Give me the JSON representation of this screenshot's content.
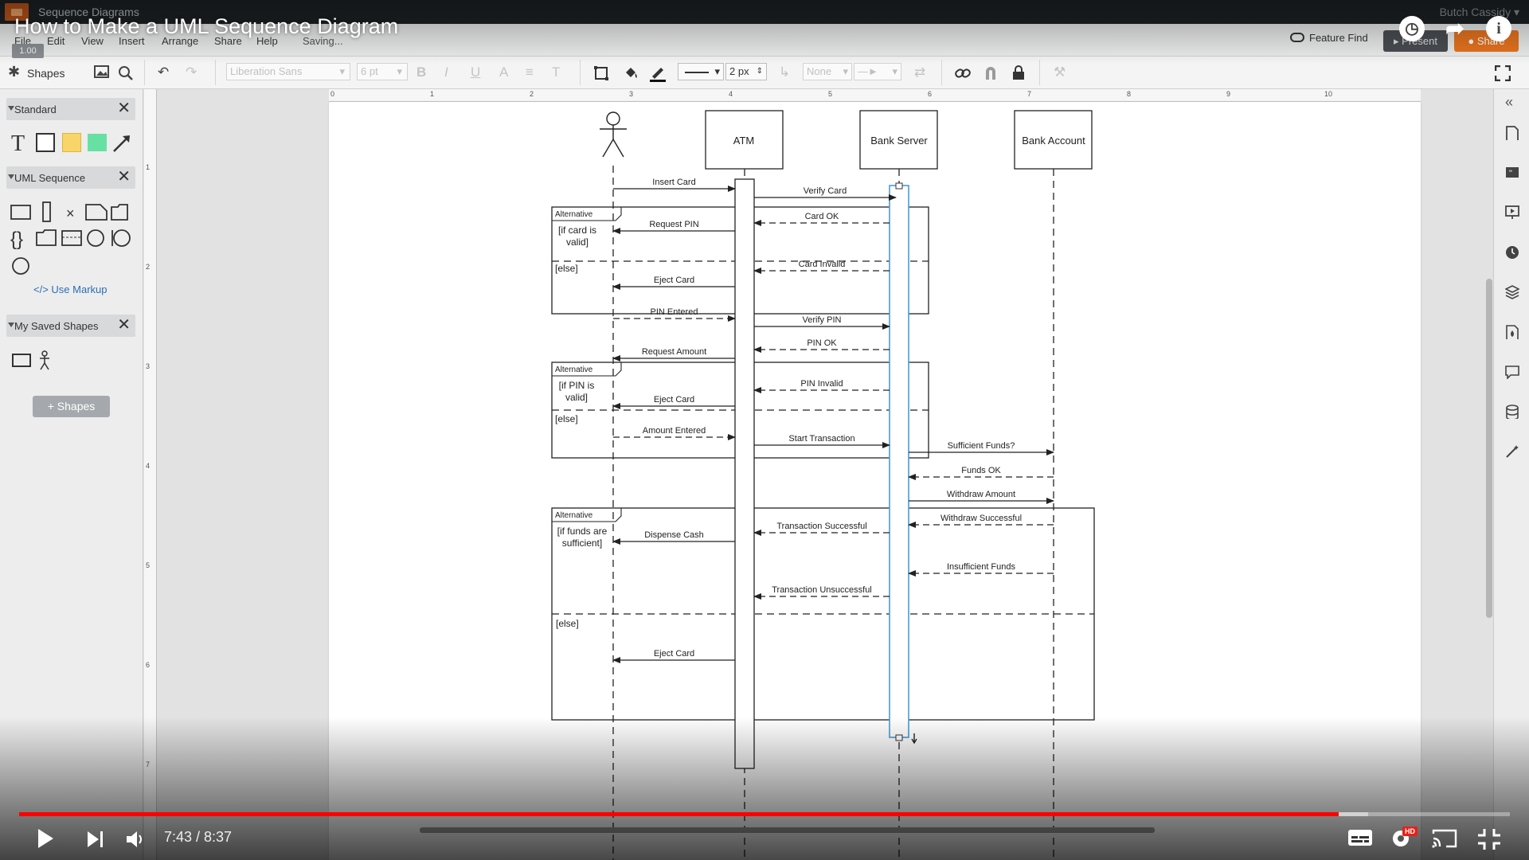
{
  "app": {
    "document_title": "Sequence Diagrams",
    "user_name": "Butch Cassidy ▾",
    "menus": [
      "File",
      "Edit",
      "View",
      "Insert",
      "Arrange",
      "Share",
      "Help"
    ],
    "status": "Saving...",
    "zoom_badge": "1.00",
    "feature_find": "Feature Find",
    "present_label": "Present",
    "share_label": "Share"
  },
  "toolbar": {
    "shapes_label": "Shapes",
    "font_family": "Liberation Sans",
    "font_size": "6 pt",
    "line_width": "2 px",
    "arrow_start": "None"
  },
  "left_panel": {
    "standard_label": "Standard",
    "uml_label": "UML Sequence",
    "use_markup": "Use Markup",
    "saved_label": "My Saved Shapes",
    "add_shapes": "Shapes"
  },
  "ruler": {
    "top_ticks": [
      "0",
      "1",
      "2",
      "3",
      "4",
      "5",
      "6",
      "7",
      "8",
      "9",
      "10"
    ],
    "left_ticks": [
      "1",
      "2",
      "3",
      "4",
      "5",
      "6",
      "7"
    ]
  },
  "diagram": {
    "lifelines": [
      "ATM",
      "Bank Server",
      "Bank Account"
    ],
    "fragment_tag": "Alternative",
    "else_label": "[else]",
    "guards": [
      "[if card is",
      "valid]",
      "[if PIN is",
      "valid]",
      "[if funds are",
      "sufficient]"
    ],
    "messages": [
      "Insert Card",
      "Verify Card",
      "Card OK",
      "Request PIN",
      "Card Invalid",
      "Eject Card",
      "PIN Entered",
      "Verify PIN",
      "PIN OK",
      "Request Amount",
      "PIN Invalid",
      "Eject Card",
      "Amount Entered",
      "Start Transaction",
      "Sufficient Funds?",
      "Funds OK",
      "Withdraw Amount",
      "Withdraw Successful",
      "Transaction Successful",
      "Dispense Cash",
      "Insufficient Funds",
      "Transaction Unsuccessful",
      "Eject Card"
    ]
  },
  "video": {
    "title": "How to Make a UML Sequence Diagram",
    "current_time": "7:43",
    "duration": "8:37",
    "time_display": "7:43 / 8:37",
    "progress": 0.885,
    "hd_badge": "HD"
  }
}
